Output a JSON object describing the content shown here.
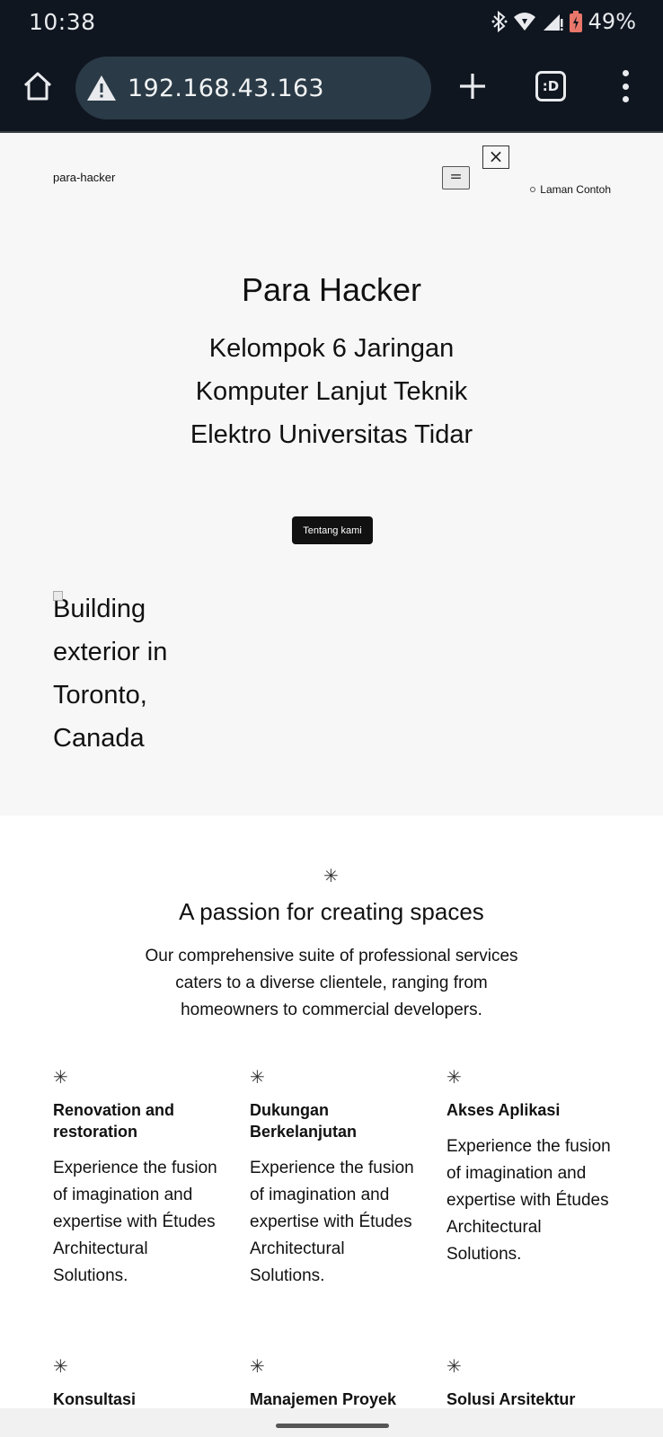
{
  "status_bar": {
    "time": "10:38",
    "battery": "49%",
    "icons": [
      "bluetooth-icon",
      "wifi-icon",
      "signal-icon",
      "battery-icon"
    ]
  },
  "browser": {
    "url": "192.168.43.163",
    "tabs_count_label": ":D",
    "icons": [
      "home-icon",
      "warning-icon",
      "plus-icon",
      "tabs-icon",
      "overflow-menu-icon"
    ]
  },
  "header": {
    "site_title": "para-hacker",
    "close_label": "×",
    "menu_toggle_label": "=",
    "nav_items": [
      {
        "label": "Laman Contoh"
      }
    ]
  },
  "hero": {
    "title": "Para Hacker",
    "subtitle": "Kelompok 6 Jaringan Komputer Lanjut Teknik Elektro Universitas Tidar",
    "button_label": "Tentang kami",
    "image_alt": "Building exterior in Toronto, Canada"
  },
  "services": {
    "heading": "A passion for creating spaces",
    "description": "Our comprehensive suite of professional services caters to a diverse clientele, ranging from homeowners to commercial developers.",
    "cards": [
      {
        "title": "Renovation and restoration",
        "text": "Experience the fusion of imagination and expertise with Études Architectural Solutions."
      },
      {
        "title": "Dukungan Berkelanjutan",
        "text": "Experience the fusion of imagination and expertise with Études Architectural Solutions."
      },
      {
        "title": "Akses Aplikasi",
        "text": "Experience the fusion of imagination and expertise with Études Architectural Solutions."
      },
      {
        "title": "Konsultasi",
        "text": ""
      },
      {
        "title": "Manajemen Proyek",
        "text": ""
      },
      {
        "title": "Solusi Arsitektur",
        "text": ""
      }
    ],
    "asterisk": "✳"
  },
  "colors": {
    "status_bar_bg": "#0f1620",
    "url_bar_bg": "#2a3a46",
    "hero_bg": "#f7f7f7",
    "button_bg": "#111111"
  }
}
